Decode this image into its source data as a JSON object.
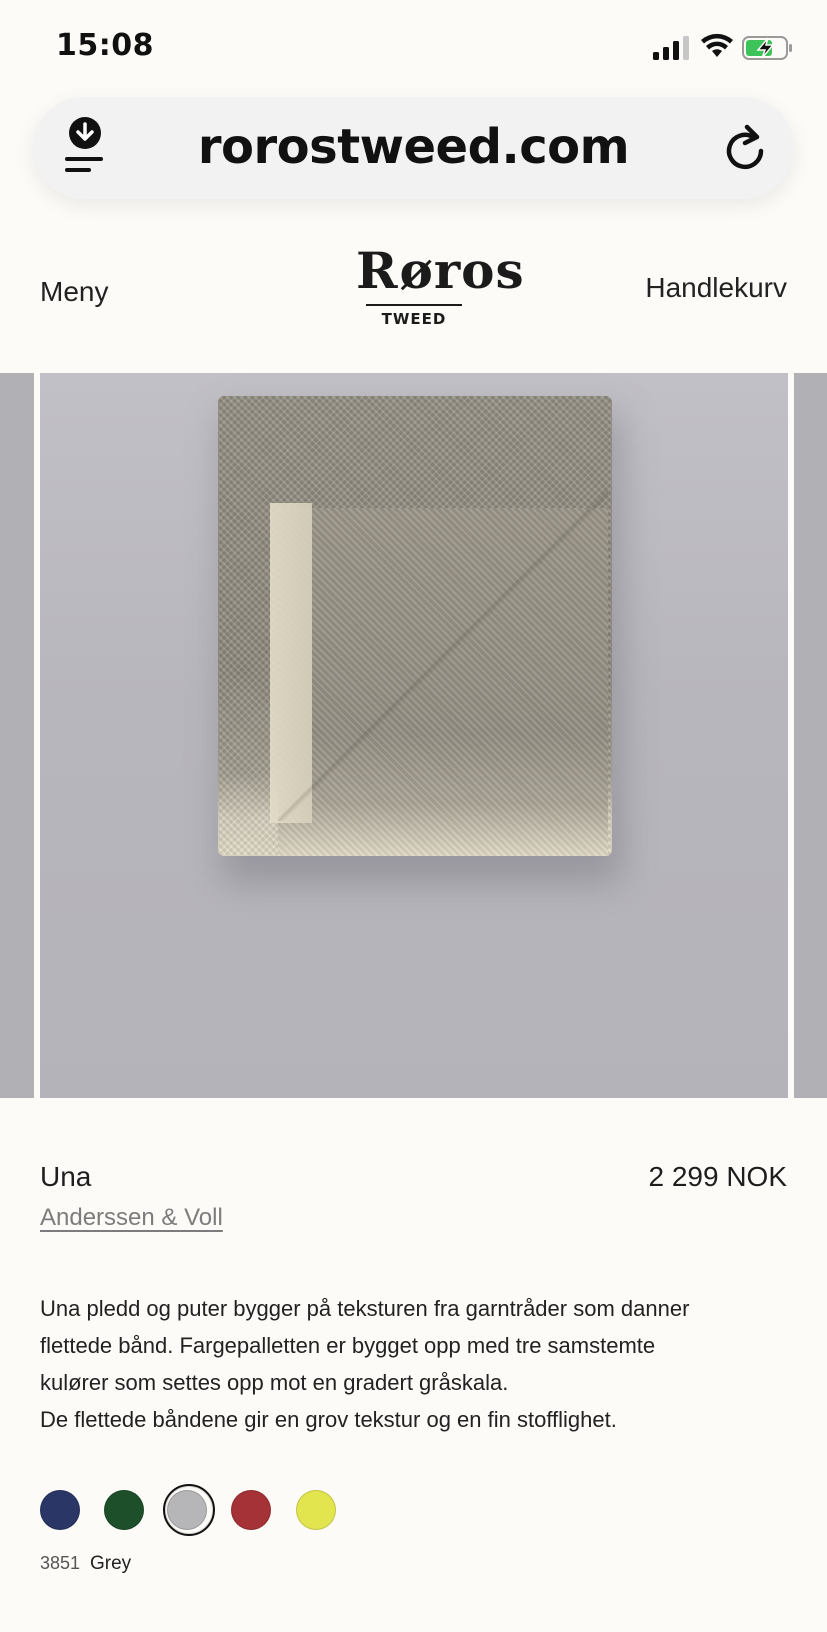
{
  "status_bar": {
    "time": "15:08"
  },
  "browser": {
    "url": "rorostweed.com"
  },
  "header": {
    "menu_label": "Meny",
    "logo_word": "Røros",
    "logo_sub": "TWEED",
    "cart_label": "Handlekurv"
  },
  "product": {
    "name": "Una",
    "price": "2 299 NOK",
    "brand": "Anderssen & Voll",
    "description": [
      "Una pledd og puter bygger på teksturen fra garntråder som danner",
      "flettede bånd. Fargepalletten er bygget opp med tre samstemte",
      "kulører som settes opp mot en gradert gråskala.",
      "De flettede båndene gir en grov tekstur og en fin stofflighet."
    ],
    "swatches": [
      {
        "color": "#2a3766"
      },
      {
        "color": "#1d4f2a"
      },
      {
        "color": "#b6b6b8",
        "selected": true
      },
      {
        "color": "#a43236"
      },
      {
        "color": "#e3e54e"
      }
    ],
    "selected_color": {
      "code": "3851",
      "name": "Grey"
    }
  }
}
